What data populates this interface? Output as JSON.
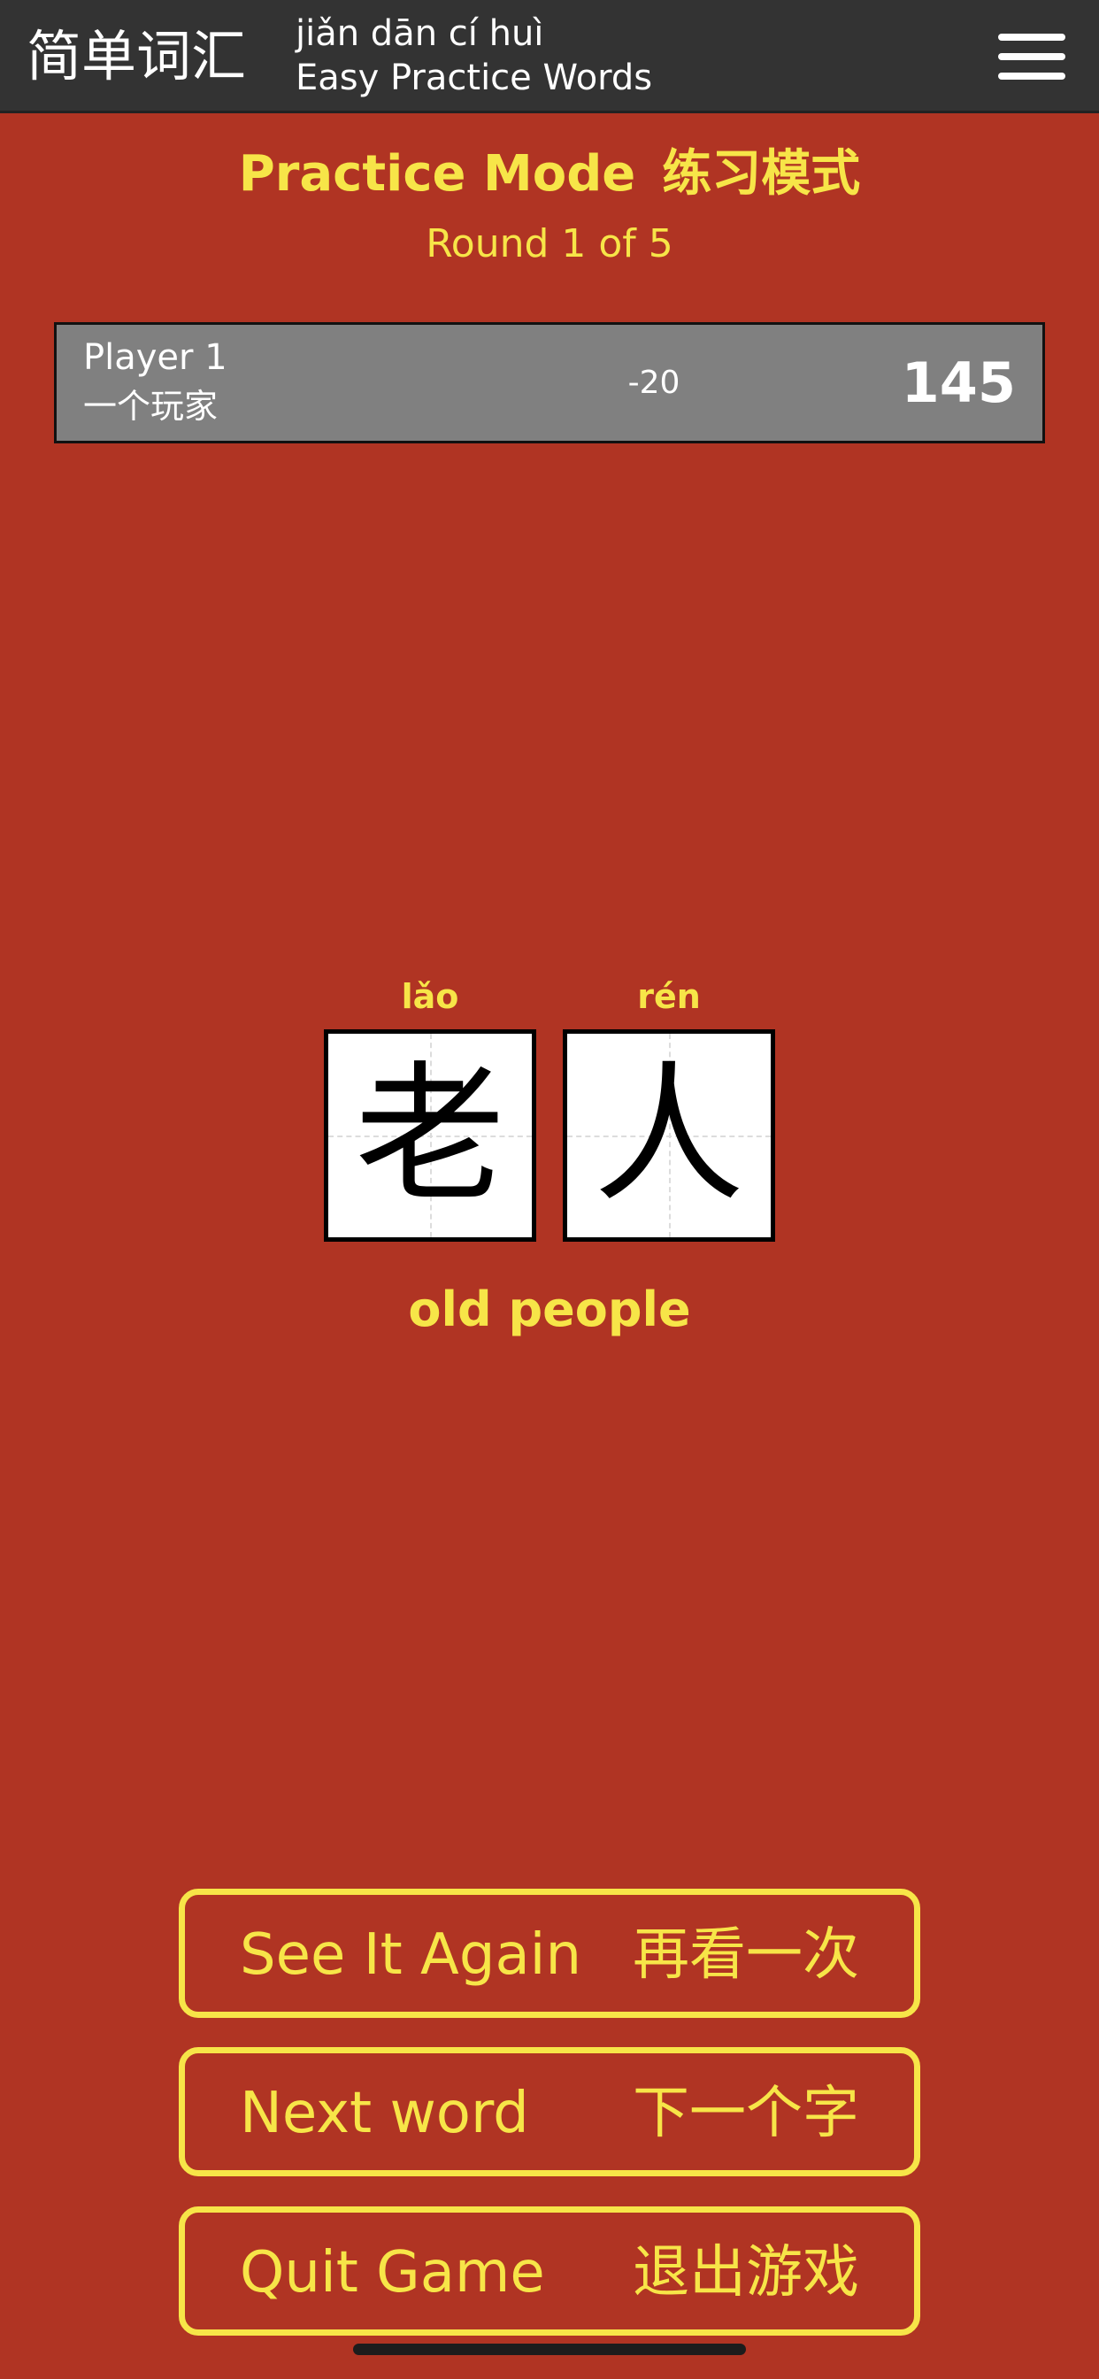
{
  "header": {
    "title_cn": "简单词汇",
    "title_pinyin": "jiǎn dān cí huì",
    "title_en": "Easy Practice Words",
    "menu_icon": "hamburger-menu-icon"
  },
  "mode": {
    "title_en": "Practice Mode",
    "title_cn": "练习模式",
    "round": "Round 1 of 5"
  },
  "player": {
    "name": "Player 1",
    "name_cn": "一个玩家",
    "delta": "-20",
    "score": "145"
  },
  "word": {
    "characters": [
      {
        "pinyin": "lǎo",
        "hanzi": "老"
      },
      {
        "pinyin": "rén",
        "hanzi": "人"
      }
    ],
    "meaning": "old people"
  },
  "buttons": {
    "see_again_en": "See It Again",
    "see_again_cn": "再看一次",
    "next_en": "Next word",
    "next_cn": "下一个字",
    "quit_en": "Quit Game",
    "quit_cn": "退出游戏"
  },
  "colors": {
    "background": "#b03423",
    "header": "#333333",
    "accent": "#f7e548",
    "player_card": "#808080"
  }
}
